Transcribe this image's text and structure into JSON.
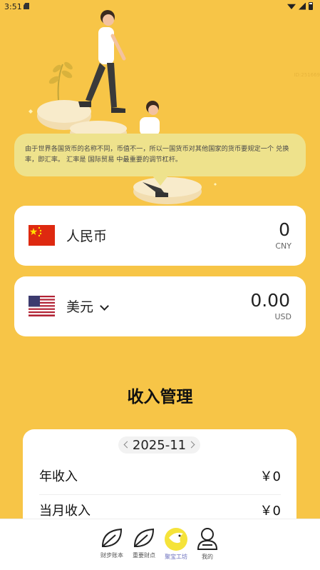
{
  "status_bar": {
    "time": "3:51"
  },
  "illustration": {
    "id_text": "ID:251669"
  },
  "banner": {
    "text": "由于世界各国货币的名称不同，币值不一，所以一国货币对其他国家的货币要规定一个 兑换率，即汇率。 汇率是 国际贸易 中最重要的调节杠杆。"
  },
  "converter": {
    "from": {
      "name": "人民币",
      "value": "0",
      "code": "CNY",
      "flag_icon": "china-flag-icon"
    },
    "to": {
      "name": "美元",
      "value": "0.00",
      "code": "USD",
      "flag_icon": "usa-flag-icon"
    }
  },
  "income": {
    "title": "收入管理",
    "month": "2025-11",
    "rows": [
      {
        "label": "年收入",
        "value": "￥0"
      },
      {
        "label": "当月收入",
        "value": "￥0"
      }
    ]
  },
  "nav": {
    "items": [
      {
        "label": "财步账本",
        "icon": "leaf-icon"
      },
      {
        "label": "重要财点",
        "icon": "leaf-icon"
      },
      {
        "label": "聚宝工坊",
        "icon": "bird-icon",
        "active": true
      },
      {
        "label": "我的",
        "icon": "user-icon"
      }
    ]
  },
  "colors": {
    "background": "#F7C547",
    "bubble": "#EEE28C",
    "active_nav": "#6b6fbd"
  }
}
